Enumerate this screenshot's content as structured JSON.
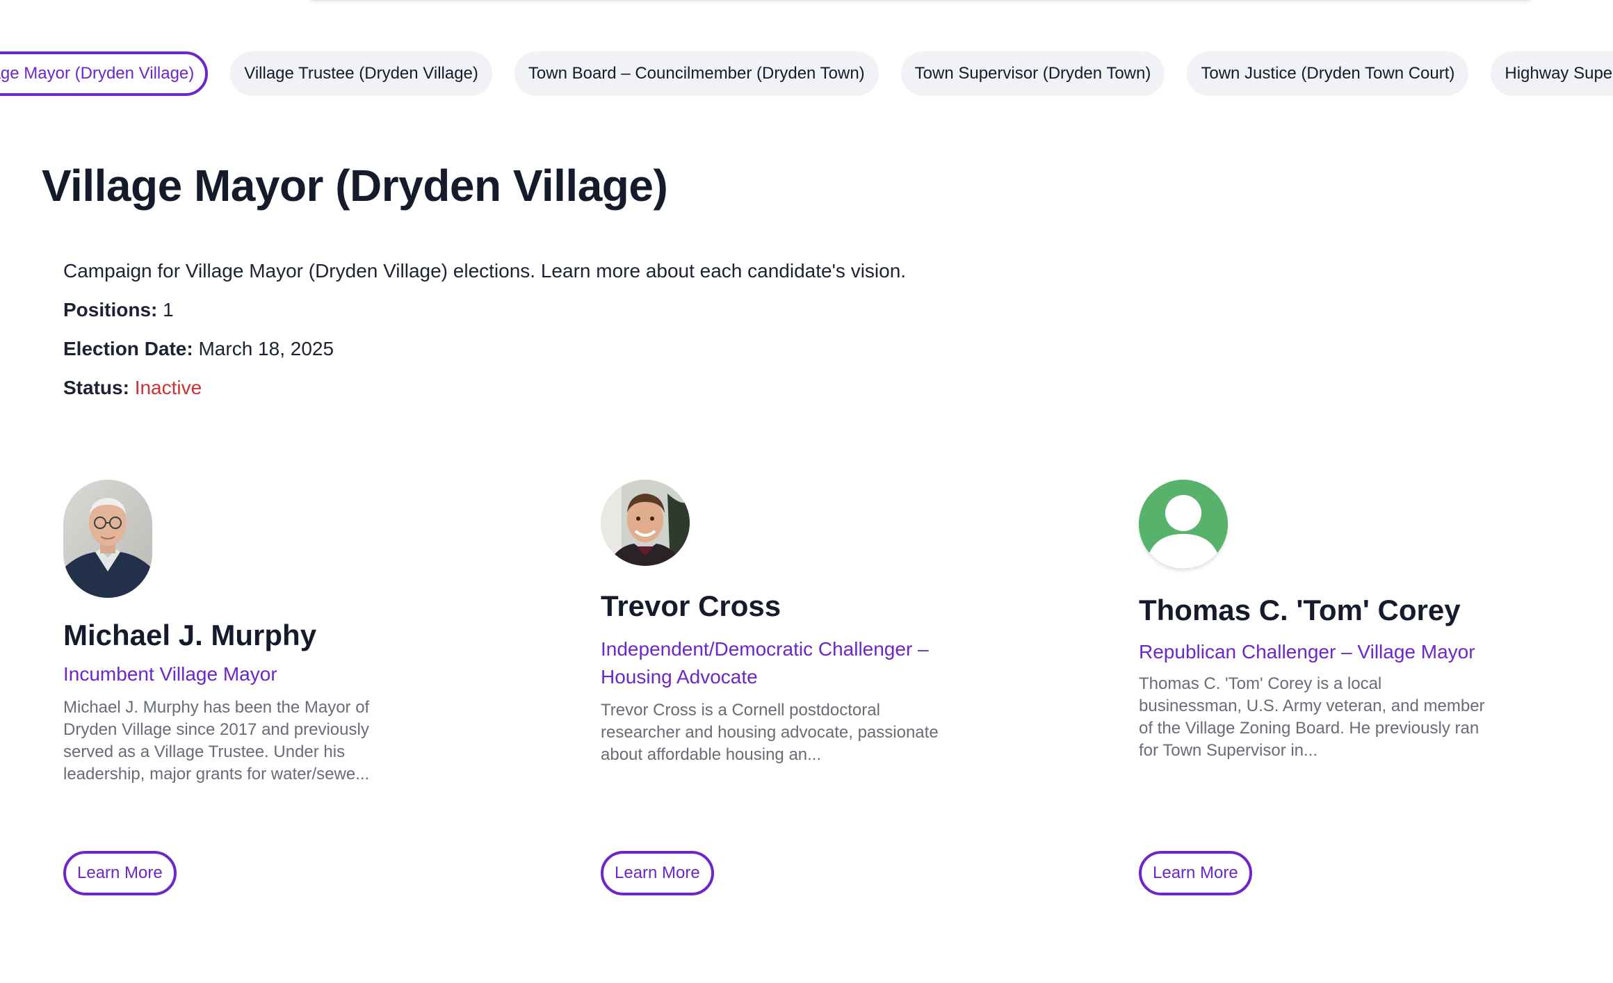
{
  "tabs": [
    {
      "label": "Village Mayor (Dryden Village)"
    },
    {
      "label": "Village Trustee (Dryden Village)"
    },
    {
      "label": "Town Board – Councilmember (Dryden Town)"
    },
    {
      "label": "Town Supervisor (Dryden Town)"
    },
    {
      "label": "Town Justice (Dryden Town Court)"
    },
    {
      "label": "Highway Superintendent"
    }
  ],
  "race": {
    "title": "Village Mayor (Dryden Village)",
    "description": "Campaign for Village Mayor (Dryden Village) elections. Learn more about each candidate's vision.",
    "positions_label": "Positions:",
    "positions_value": "1",
    "date_label": "Election Date:",
    "date_value": "March 18, 2025",
    "status_label": "Status:",
    "status_value": "Inactive",
    "status_color": "#cf3131"
  },
  "candidates": [
    {
      "name": "Michael J. Murphy",
      "role": "Incumbent Village Mayor",
      "bio": "Michael J. Murphy has been the Mayor of Dryden Village since 2017 and previously served as a Village Trustee. Under his leadership, major grants for water/sewe...",
      "button": "Learn More",
      "photo": "portrait-older-man-glasses"
    },
    {
      "name": "Trevor Cross",
      "role": "Independent/Democratic Challenger – Housing Advocate",
      "bio": "Trevor Cross is a Cornell postdoctoral researcher and housing advocate, passionate about affordable housing an...",
      "button": "Learn More",
      "photo": "portrait-young-man-smiling"
    },
    {
      "name": "Thomas C. 'Tom' Corey",
      "role": "Republican Challenger – Village Mayor",
      "bio": "Thomas C. 'Tom' Corey is a local businessman, U.S. Army veteran, and member of the Village Zoning Board. He previously ran for Town Supervisor in...",
      "button": "Learn More",
      "photo": "default-user-icon"
    }
  ],
  "colors": {
    "accent": "#6d26c9",
    "text": "#161b2b",
    "muted": "#676c77",
    "tab_bg": "#f1f2f5",
    "default_avatar": "#57b36c"
  }
}
